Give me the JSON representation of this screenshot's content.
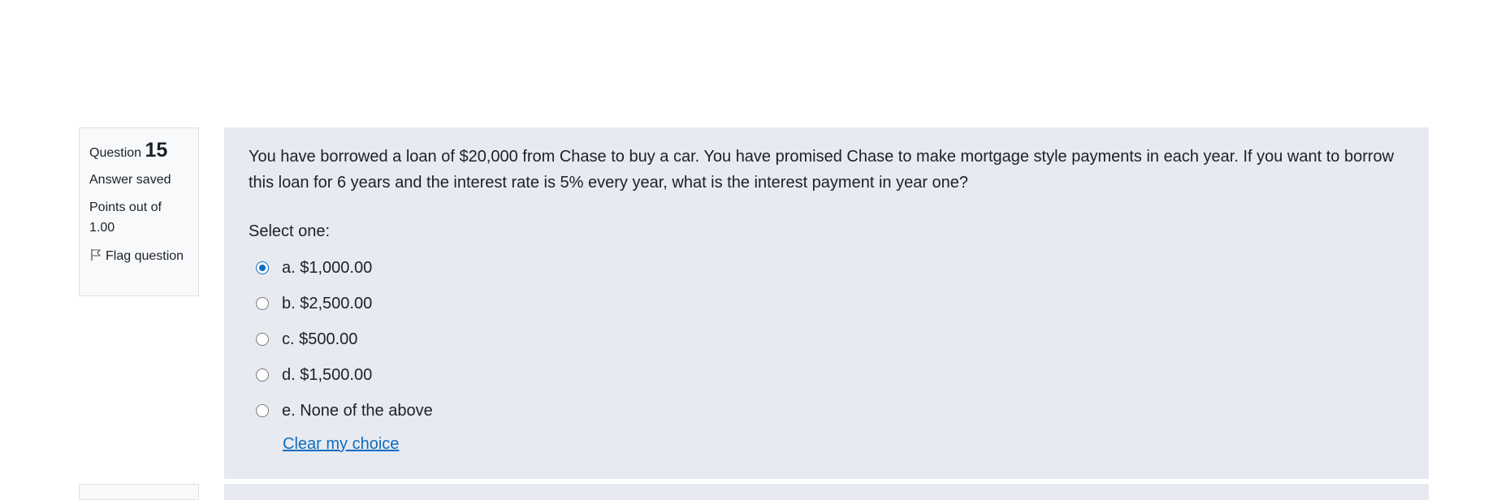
{
  "question_info": {
    "label": "Question",
    "number": "15",
    "state": "Answer saved",
    "grade": "Points out of 1.00",
    "flag_label": "Flag question"
  },
  "question": {
    "text": "You have borrowed a loan of $20,000 from Chase to buy a car. You have promised Chase to make mortgage style payments in each year. If you want to borrow this loan for 6 years and the interest rate is 5% every year, what is the interest payment in year one?",
    "prompt": "Select one:",
    "options": [
      {
        "label": "a. $1,000.00",
        "selected": true
      },
      {
        "label": "b. $2,500.00",
        "selected": false
      },
      {
        "label": "c. $500.00",
        "selected": false
      },
      {
        "label": "d. $1,500.00",
        "selected": false
      },
      {
        "label": "e. None of the above",
        "selected": false
      }
    ],
    "clear_label": "Clear my choice"
  },
  "colors": {
    "accent": "#0f6cbf",
    "panel_bg": "#e7eaf0",
    "info_bg": "#f8f9fa"
  }
}
